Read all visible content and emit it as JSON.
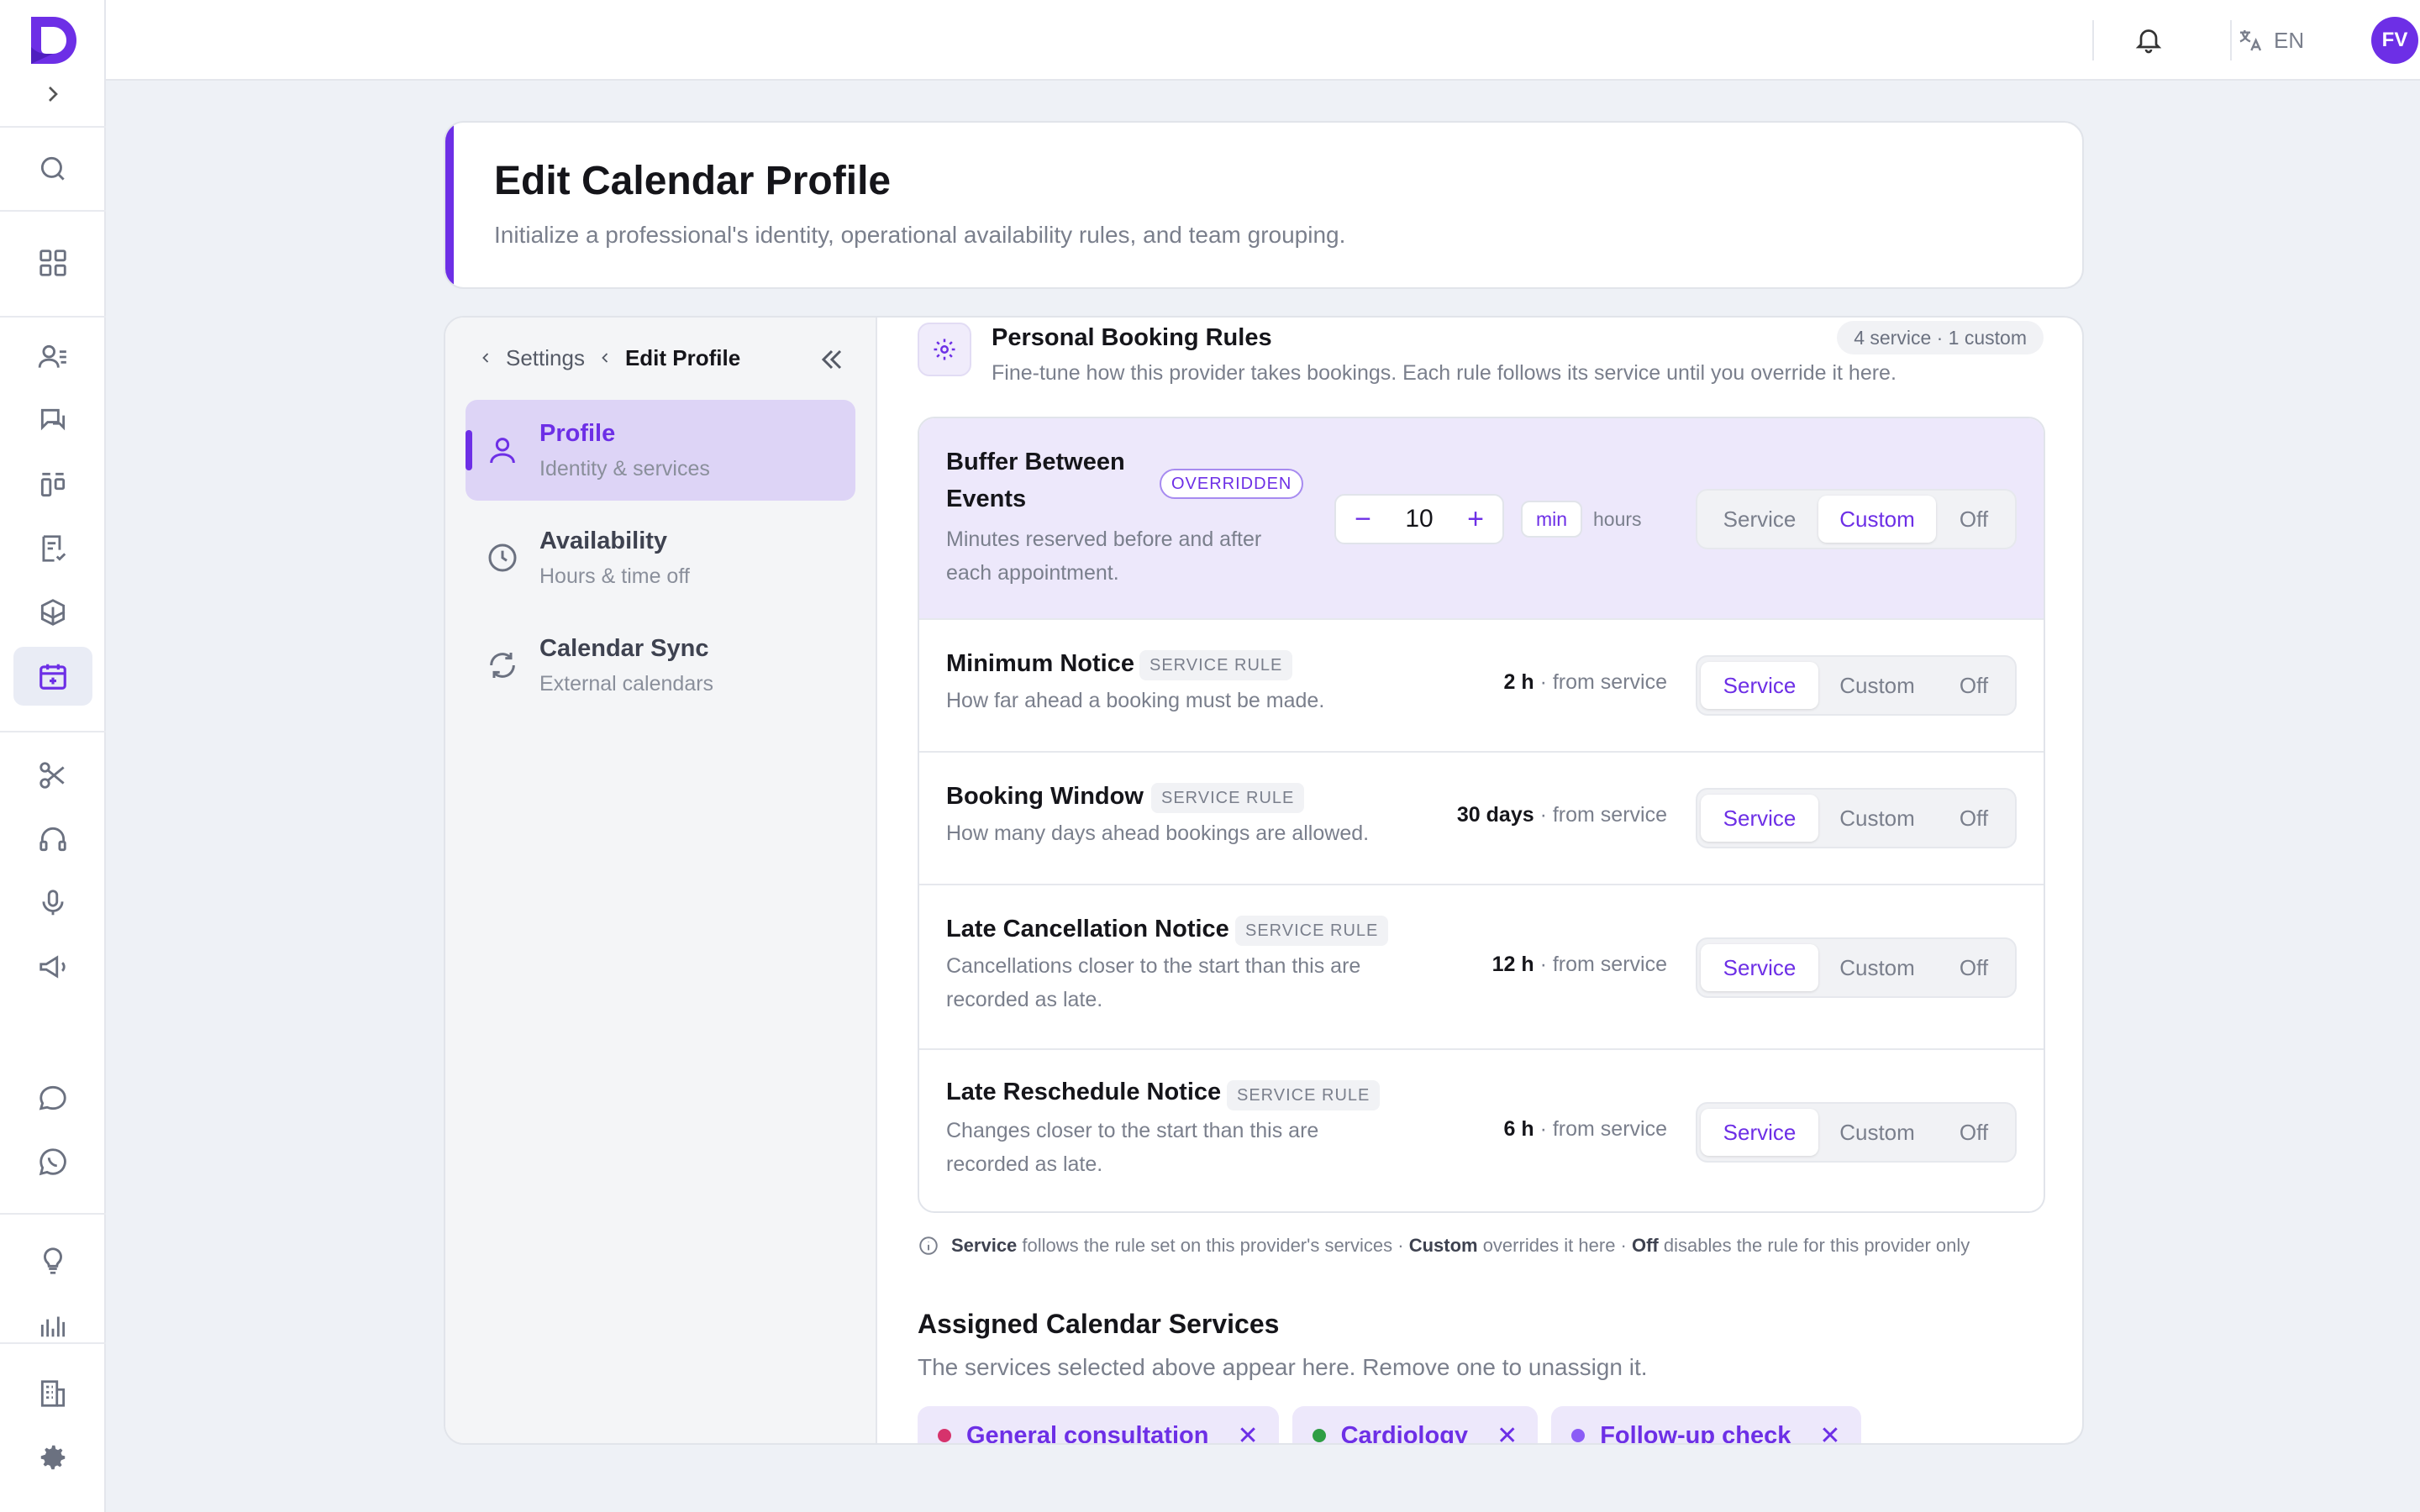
{
  "topbar": {
    "language": "EN",
    "avatar_initials": "FV"
  },
  "header": {
    "title": "Edit Calendar Profile",
    "subtitle": "Initialize a professional's identity, operational availability rules, and team grouping."
  },
  "breadcrumb": {
    "parent": "Settings",
    "current": "Edit Profile"
  },
  "sidenav": {
    "items": [
      {
        "title": "Profile",
        "subtitle": "Identity & services"
      },
      {
        "title": "Availability",
        "subtitle": "Hours & time off"
      },
      {
        "title": "Calendar Sync",
        "subtitle": "External calendars"
      }
    ]
  },
  "booking_rules": {
    "title": "Personal Booking Rules",
    "description": "Fine-tune how this provider takes bookings. Each rule follows its service until you override it here.",
    "badge": "4 service · 1 custom",
    "segment_options": [
      "Service",
      "Custom",
      "Off"
    ],
    "rules": [
      {
        "title_line1": "Buffer Between",
        "title_line2": "Events",
        "tag": "OVERRIDDEN",
        "desc_line1": "Minutes reserved before and after",
        "desc_line2": "each appointment.",
        "stepper_value": "10",
        "unit_selected": "min",
        "unit_other": "hours",
        "selected": "Custom"
      },
      {
        "title": "Minimum Notice",
        "tag": "SERVICE RULE",
        "desc_line1": "How far ahead a booking must be made.",
        "value": "2 h",
        "value_suffix": " · from service",
        "selected": "Service"
      },
      {
        "title": "Booking Window",
        "tag": "SERVICE RULE",
        "desc_line1": "How many days ahead bookings are allowed.",
        "value": "30 days",
        "value_suffix": " · from service",
        "selected": "Service"
      },
      {
        "title": "Late Cancellation Notice",
        "tag": "SERVICE RULE",
        "desc_line1": "Cancellations closer to the start than this are",
        "desc_line2": "recorded as late.",
        "value": "12 h",
        "value_suffix": " · from service",
        "selected": "Service"
      },
      {
        "title": "Late Reschedule Notice",
        "tag": "SERVICE RULE",
        "desc_line1": "Changes closer to the start than this are",
        "desc_line2": "recorded as late.",
        "value": "6 h",
        "value_suffix": " · from service",
        "selected": "Service"
      }
    ]
  },
  "legend": {
    "service_term": "Service",
    "service_text": " follows the rule set on this provider's services · ",
    "custom_term": "Custom",
    "custom_text": " overrides it here · ",
    "off_term": "Off",
    "off_text": " disables the rule for this provider only"
  },
  "assigned": {
    "title": "Assigned Calendar Services",
    "subtitle": "The services selected above appear here. Remove one to unassign it.",
    "chips": [
      {
        "label": "General consultation",
        "color": "#d6336c"
      },
      {
        "label": "Cardiology",
        "color": "#2f9e44"
      },
      {
        "label": "Follow-up check",
        "color": "#8b5cf6"
      }
    ]
  },
  "colors": {
    "accent": "#6d2fe6",
    "highlight": "#ede8fb"
  }
}
